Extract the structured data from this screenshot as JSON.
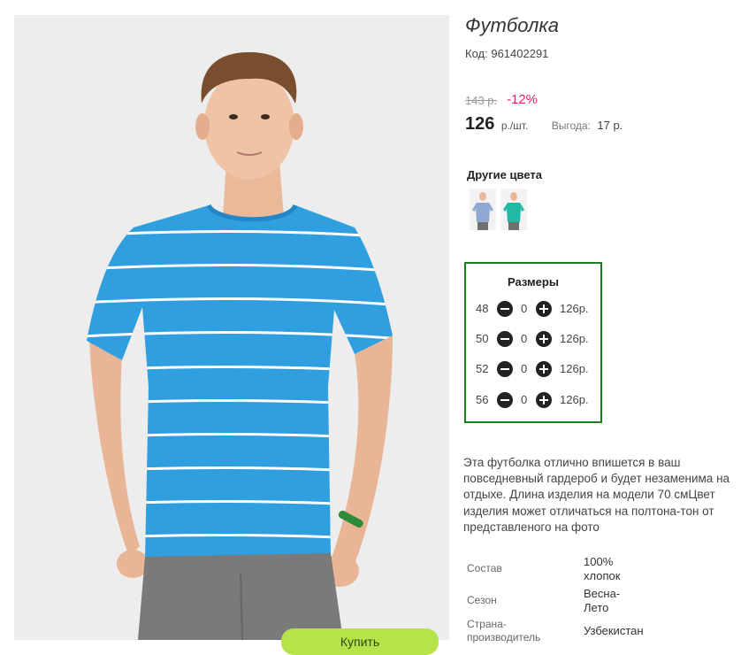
{
  "product": {
    "title": "Футболка",
    "code_label": "Код:",
    "code_value": "961402291",
    "old_price": "143 р.",
    "discount": "-12%",
    "price": "126",
    "price_unit": "р./шт.",
    "benefit_label": "Выгода:",
    "benefit_value": "17 р.",
    "accent_color": "#e0245e"
  },
  "colors": {
    "heading": "Другие цвета",
    "swatches": [
      {
        "shirt_color": "#8fa8d4"
      },
      {
        "shirt_color": "#1fb9a5"
      }
    ]
  },
  "sizes": {
    "title": "Размеры",
    "border_color": "#1b7d1b",
    "rows": [
      {
        "size": "48",
        "qty": "0",
        "price": "126р."
      },
      {
        "size": "50",
        "qty": "0",
        "price": "126р."
      },
      {
        "size": "52",
        "qty": "0",
        "price": "126р."
      },
      {
        "size": "56",
        "qty": "0",
        "price": "126р."
      }
    ]
  },
  "description": "Эта футболка отлично впишется в ваш повседневный гардероб и будет незаменима на отдыхе. Длина изделия на модели 70 смЦвет изделия может отличаться на полтона-тон от представленого на фото",
  "specs": [
    {
      "label": "Состав",
      "value": "100% хлопок"
    },
    {
      "label": "Сезон",
      "value": "Весна-Лето"
    },
    {
      "label": "Страна-производитель",
      "value": "Узбекистан"
    }
  ],
  "buy_button": {
    "label": "Купить"
  },
  "photo": {
    "shirt_color": "#2f9fe0",
    "stripe_color": "#ffffff",
    "pants_color": "#7a7a7a"
  }
}
